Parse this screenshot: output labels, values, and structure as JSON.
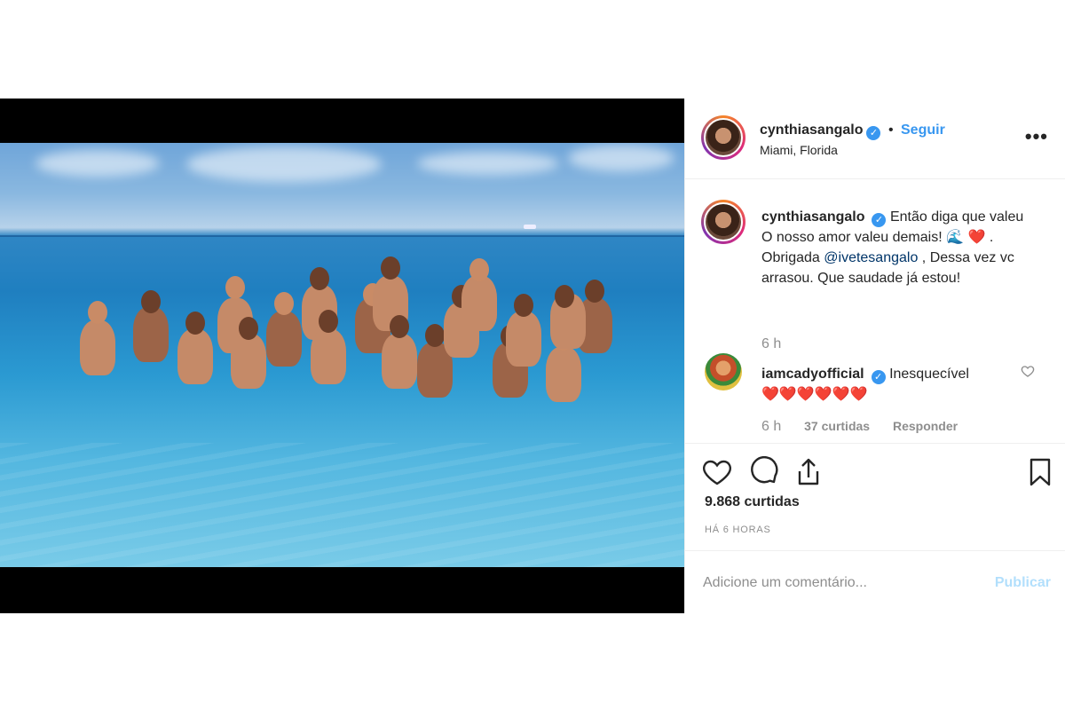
{
  "post": {
    "author": {
      "username": "cynthiasangalo",
      "verified": true,
      "follow_label": "Seguir",
      "separator": "•",
      "location": "Miami, Florida"
    },
    "more_icon": "more-horizontal-icon",
    "more_label": "•••"
  },
  "caption": {
    "username": "cynthiasangalo",
    "line1": "Então diga que valeu",
    "line2_pre": "O nosso amor valeu demais! ",
    "line2_emoji_wave": "🌊",
    "line2_emoji_heart": "❤️",
    "line2_post": " .",
    "line3_pre": "Obrigada ",
    "mention": "@ivetesangalo",
    "line3_post": " , Dessa vez vc arrasou. Que saudade já estou!",
    "time": "6 h"
  },
  "reply": {
    "username": "iamcadyofficial",
    "verified": true,
    "text": "Inesquecível",
    "hearts": "❤️❤️❤️❤️❤️❤️",
    "time": "6 h",
    "likes": "37 curtidas",
    "reply_label": "Responder"
  },
  "actions": {
    "likes": "9.868 curtidas",
    "timestamp": "HÁ 6 HORAS",
    "icons": [
      "heart-icon",
      "comment-icon",
      "share-icon",
      "bookmark-icon"
    ]
  },
  "comment_box": {
    "placeholder": "Adicione um comentário...",
    "publish_label": "Publicar"
  },
  "colors": {
    "link": "#3897f0",
    "publish_disabled": "#b2dffc",
    "muted": "#8e8e8e",
    "mention": "#003569"
  }
}
